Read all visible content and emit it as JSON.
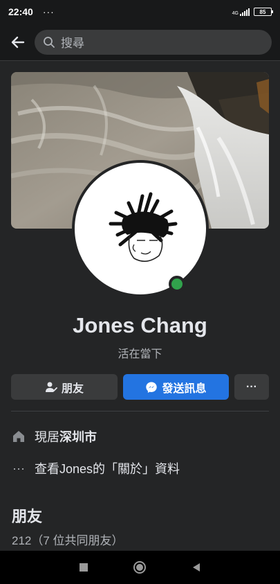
{
  "status": {
    "time": "22:40",
    "dots": "···",
    "network": "4G",
    "battery": "85"
  },
  "search": {
    "placeholder": "搜尋"
  },
  "profile": {
    "name": "Jones Chang",
    "bio": "活在當下",
    "online": true
  },
  "actions": {
    "friends_label": "朋友",
    "message_label": "發送訊息",
    "more_label": "···"
  },
  "info": {
    "home_prefix": "現居",
    "home_city": "深圳市",
    "about_dots": "···",
    "about_text": "查看Jones的「關於」資料"
  },
  "friends": {
    "title": "朋友",
    "count": "212（7 位共同朋友）"
  },
  "colors": {
    "background": "#242526",
    "accent": "#2374e1",
    "online": "#31a24c"
  },
  "icons": [
    "back-arrow-icon",
    "search-icon",
    "person-check-icon",
    "messenger-icon",
    "home-icon",
    "more-dots-icon",
    "square-icon",
    "circle-icon",
    "triangle-back-icon"
  ]
}
